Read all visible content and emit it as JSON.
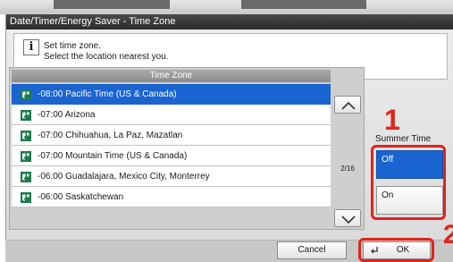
{
  "window": {
    "title": "Date/Timer/Energy Saver - Time Zone"
  },
  "message": {
    "icon": "info-icon",
    "line1": "Set time zone.",
    "line2": "Select the location nearest you."
  },
  "list": {
    "header": "Time Zone",
    "items": [
      {
        "label": "-08:00 Pacific Time (US & Canada)",
        "selected": true
      },
      {
        "label": "-07:00 Arizona",
        "selected": false
      },
      {
        "label": "-07:00 Chihuahua, La Paz, Mazatlan",
        "selected": false
      },
      {
        "label": "-07:00 Mountain Time (US & Canada)",
        "selected": false
      },
      {
        "label": "-06:00 Guadalajara, Mexico City, Monterrey",
        "selected": false
      },
      {
        "label": "-06:00 Saskatchewan",
        "selected": false
      }
    ],
    "page_indicator": "2/16"
  },
  "summer_time": {
    "label": "Summer Time",
    "options": [
      "Off",
      "On"
    ],
    "selected": "Off"
  },
  "annotations": {
    "marker1": "1",
    "marker2": "2"
  },
  "buttons": {
    "cancel": "Cancel",
    "ok": "OK"
  },
  "colors": {
    "selection": "#1a64d2",
    "annotation": "#e2231a"
  }
}
